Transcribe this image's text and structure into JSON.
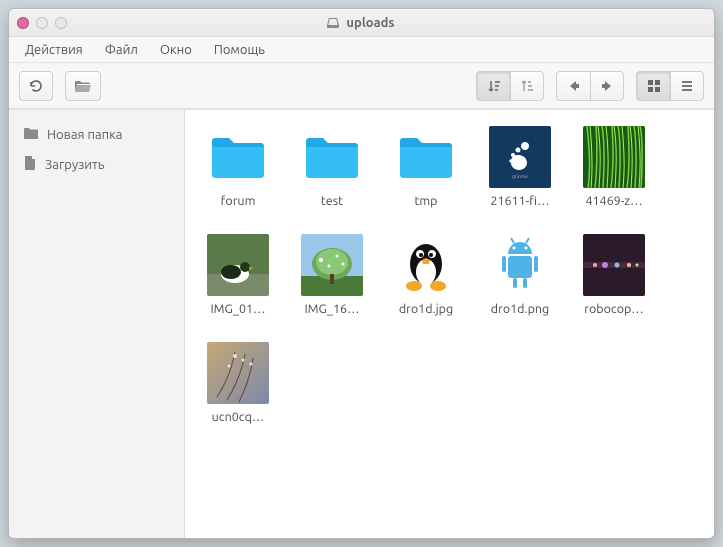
{
  "window": {
    "title": "uploads"
  },
  "menu": {
    "actions": "Действия",
    "file": "Файл",
    "window": "Окно",
    "help": "Помощь"
  },
  "sidebar": {
    "new_folder": "Новая папка",
    "upload": "Загрузить"
  },
  "items": [
    {
      "name": "forum",
      "kind": "folder"
    },
    {
      "name": "test",
      "kind": "folder"
    },
    {
      "name": "tmp",
      "kind": "folder"
    },
    {
      "name": "21611-fi…",
      "kind": "img-gnome"
    },
    {
      "name": "41469-z…",
      "kind": "img-grass"
    },
    {
      "name": "IMG_01…",
      "kind": "img-duck"
    },
    {
      "name": "IMG_16…",
      "kind": "img-tree"
    },
    {
      "name": "dro1d.jpg",
      "kind": "img-tux"
    },
    {
      "name": "dro1d.png",
      "kind": "img-android"
    },
    {
      "name": "robocop…",
      "kind": "img-dark"
    },
    {
      "name": "ucn0cq…",
      "kind": "img-flowers"
    }
  ],
  "colors": {
    "folder": "#2fb4f0",
    "accent": "#6b6b6b"
  }
}
